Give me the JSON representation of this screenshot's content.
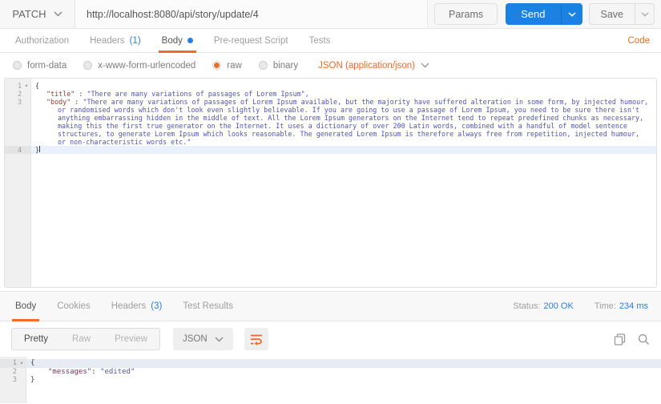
{
  "topbar": {
    "method": "PATCH",
    "url": "http://localhost:8080/api/story/update/4",
    "params_label": "Params",
    "send_label": "Send",
    "save_label": "Save"
  },
  "request_tabs": {
    "items": [
      {
        "label": "Authorization"
      },
      {
        "label": "Headers",
        "count": "(1)"
      },
      {
        "label": "Body"
      },
      {
        "label": "Pre-request Script"
      },
      {
        "label": "Tests"
      }
    ],
    "code_link": "Code"
  },
  "body_type": {
    "options": [
      "form-data",
      "x-www-form-urlencoded",
      "raw",
      "binary"
    ],
    "selected": "raw",
    "content_type": "JSON (application/json)"
  },
  "accent_colors": {
    "orange": "#f06b24",
    "blue": "#2a7de1",
    "send_blue": "#1a82e2"
  },
  "request_editor": {
    "rows": [
      {
        "num": "1",
        "fold": true,
        "segments": [
          {
            "t": "p",
            "v": "{"
          }
        ]
      },
      {
        "num": "2",
        "indent": 14,
        "segments": [
          {
            "t": "k",
            "v": "\"title\""
          },
          {
            "t": "p",
            "v": " : "
          },
          {
            "t": "s",
            "v": "\"There are many variations of passages of Lorem Ipsum\","
          }
        ]
      },
      {
        "num": "3",
        "indent": 14,
        "segments": [
          {
            "t": "k",
            "v": "\"body\""
          },
          {
            "t": "p",
            "v": " : "
          },
          {
            "t": "s",
            "v": "\"There are many variations of passages of Lorem Ipsum available, but the majority have suffered alteration in some form, by injected humour,"
          }
        ]
      },
      {
        "indent": 28,
        "segments": [
          {
            "t": "s",
            "v": "or randomised words which don't look even slightly believable. If you are going to use a passage of Lorem Ipsum, you need to be sure there isn't"
          }
        ]
      },
      {
        "indent": 28,
        "segments": [
          {
            "t": "s",
            "v": "anything embarrassing hidden in the middle of text. All the Lorem Ipsum generators on the Internet tend to repeat predefined chunks as necessary,"
          }
        ]
      },
      {
        "indent": 28,
        "segments": [
          {
            "t": "s",
            "v": "making this the first true generator on the Internet. It uses a dictionary of over 200 Latin words, combined with a handful of model sentence"
          }
        ]
      },
      {
        "indent": 28,
        "segments": [
          {
            "t": "s",
            "v": "structures, to generate Lorem Ipsum which looks reasonable. The generated Lorem Ipsum is therefore always free from repetition, injected humour,"
          }
        ]
      },
      {
        "indent": 28,
        "segments": [
          {
            "t": "s",
            "v": "or non-characteristic words etc.\""
          }
        ]
      },
      {
        "num": "4",
        "hl": true,
        "cursor": true,
        "segments": [
          {
            "t": "p",
            "v": "}"
          }
        ]
      }
    ]
  },
  "response": {
    "tabs": [
      {
        "label": "Body"
      },
      {
        "label": "Cookies"
      },
      {
        "label": "Headers",
        "count": "(3)"
      },
      {
        "label": "Test Results"
      }
    ],
    "status_label": "Status:",
    "status_value": "200 OK",
    "time_label": "Time:",
    "time_value": "234 ms",
    "view_modes": [
      "Pretty",
      "Raw",
      "Preview"
    ],
    "view_selected": "Pretty",
    "format": "JSON",
    "icons": [
      "wrap-text-icon",
      "copy-icon",
      "search-icon"
    ]
  },
  "response_editor": {
    "rows": [
      {
        "num": "1",
        "fold": true,
        "hl": true,
        "segments": [
          {
            "t": "p",
            "v": "{"
          }
        ]
      },
      {
        "num": "2",
        "indent": 22,
        "segments": [
          {
            "t": "k",
            "v": "\"messages\""
          },
          {
            "t": "p",
            "v": ": "
          },
          {
            "t": "s",
            "v": "\"edited\""
          }
        ]
      },
      {
        "num": "3",
        "segments": [
          {
            "t": "p",
            "v": "}"
          }
        ]
      }
    ]
  }
}
